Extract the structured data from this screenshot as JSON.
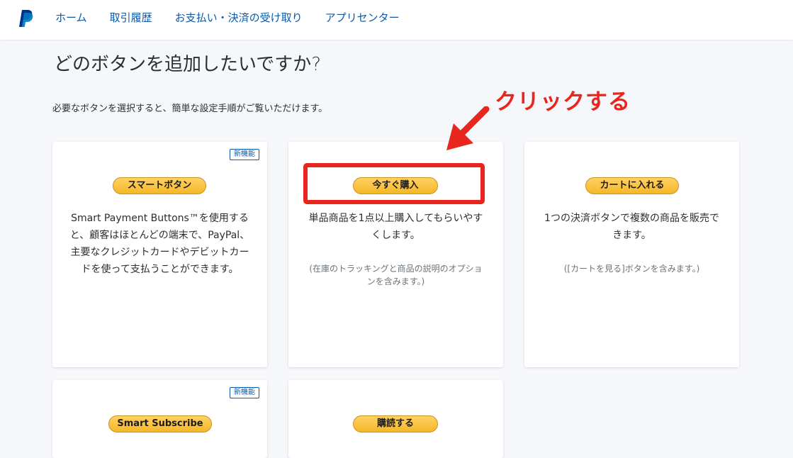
{
  "nav": {
    "items": [
      {
        "label": "ホーム"
      },
      {
        "label": "取引履歴"
      },
      {
        "label": "お支払い・決済の受け取り"
      },
      {
        "label": "アプリセンター"
      }
    ]
  },
  "main": {
    "title": "どのボタンを追加したいですか?",
    "subtitle": "必要なボタンを選択すると、簡単な設定手順がご覧いただけます。"
  },
  "annotation": {
    "callout": "クリックする",
    "color": "#e8261d"
  },
  "cards": [
    {
      "badge": "新機能",
      "button": "スマートボタン",
      "description": "Smart Payment Buttons™を使用すると、顧客はほとんどの端末で、PayPal、主要なクレジットカードやデビットカードを使って支払うことができます。",
      "note": ""
    },
    {
      "badge": "",
      "button": "今すぐ購入",
      "description": "単品商品を1点以上購入してもらいやすくします。",
      "note": "(在庫のトラッキングと商品の説明のオプションを含みます。)"
    },
    {
      "badge": "",
      "button": "カートに入れる",
      "description": "1つの決済ボタンで複数の商品を販売できます。",
      "note": "([カートを見る]ボタンを含みます。)"
    },
    {
      "badge": "新機能",
      "button": "Smart Subscribe",
      "description": "",
      "note": ""
    },
    {
      "badge": "",
      "button": "購読する",
      "description": "",
      "note": ""
    }
  ],
  "colors": {
    "link": "#0b5aa8",
    "button": "#ffc439",
    "accent": "#e8261d"
  },
  "icons": {
    "logo": "paypal-logo-icon",
    "arrow": "arrow-down-left-icon"
  }
}
